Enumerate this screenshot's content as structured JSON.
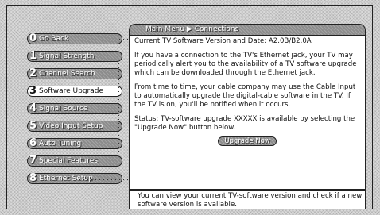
{
  "breadcrumb": "Main Menu ▶ Connections",
  "menu": [
    {
      "num": "0",
      "label": "Go Back"
    },
    {
      "num": "1",
      "label": "Signal Strength"
    },
    {
      "num": "2",
      "label": "Channel Search"
    },
    {
      "num": "3",
      "label": "Software Upgrade",
      "selected": true
    },
    {
      "num": "4",
      "label": "Signal Source"
    },
    {
      "num": "5",
      "label": "Video Input Setup"
    },
    {
      "num": "6",
      "label": "Auto Tuning"
    },
    {
      "num": "7",
      "label": "Special Features"
    },
    {
      "num": "8",
      "label": "Ethernet Setup"
    }
  ],
  "content": {
    "version_line": "Current TV Software Version and Date: A2.0B/B2.0A",
    "para1": "If you have a connection to the TV's Ethernet jack, your TV may periodically alert you to the availability of a TV software upgrade which can be downloaded through the Ethernet jack.",
    "para2": "From time to time, your cable company may use the Cable Input to automatically upgrade the digital-cable software in the TV. If the TV is on, you'll be notified when it occurs.",
    "status": "Status: TV-software upgrade XXXXX is available by selecting the \"Upgrade Now\" button below.",
    "upgrade_button": "Upgrade Now"
  },
  "help_text": "You can view your current TV-software version and check if a new software version is available."
}
